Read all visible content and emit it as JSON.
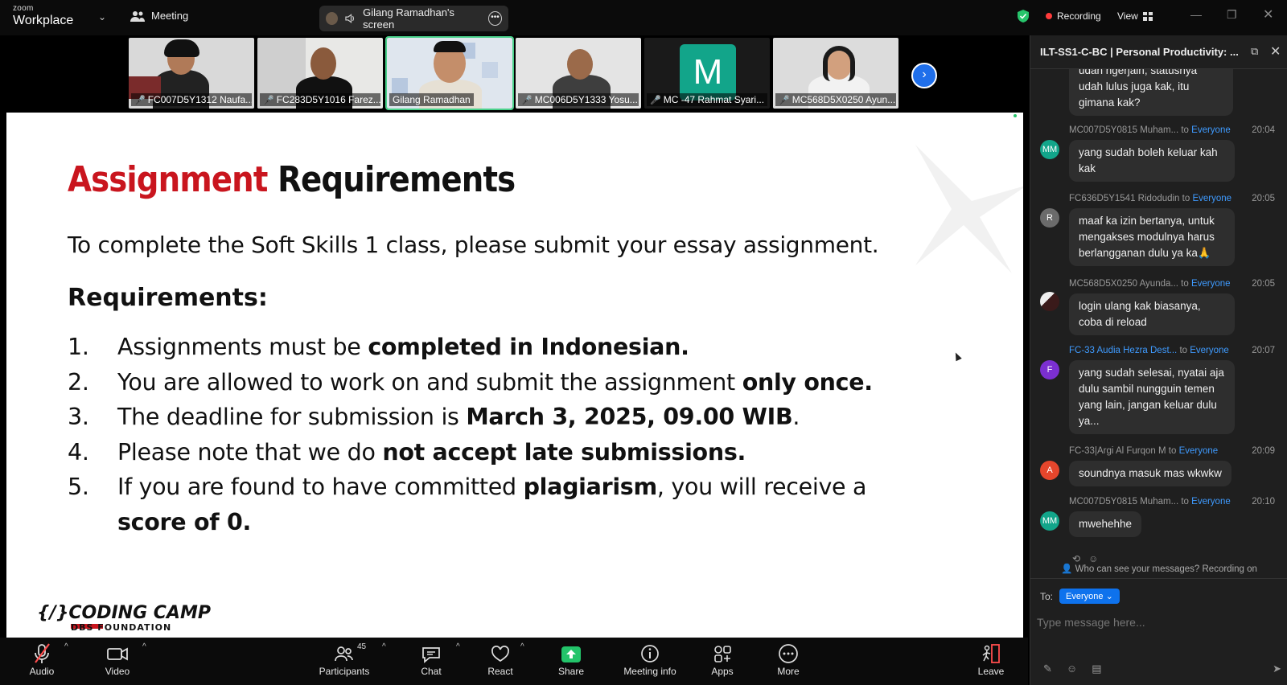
{
  "topbar": {
    "brand_small": "zoom",
    "brand_main": "Workplace",
    "meeting_label": "Meeting",
    "screen_share_label": "Gilang Ramadhan's screen",
    "recording_label": "Recording",
    "view_label": "View"
  },
  "thumbnails": [
    {
      "label": "FC007D5Y1312 Naufa...",
      "muted": true
    },
    {
      "label": "FC283D5Y1016 Farez...",
      "muted": true
    },
    {
      "label": "Gilang Ramadhan",
      "muted": false,
      "active": true
    },
    {
      "label": "MC006D5Y1333 Yosu...",
      "muted": true
    },
    {
      "label": "MC -47 Rahmat Syari...",
      "muted": true,
      "avatar_letter": "M"
    },
    {
      "label": "MC568D5X0250 Ayun...",
      "muted": true
    }
  ],
  "slide": {
    "title_red": "Assignment",
    "title_black": "Requirements",
    "intro": "To complete the Soft Skills 1 class, please submit your essay assignment.",
    "req_heading": "Requirements:",
    "items": [
      {
        "num": "1.",
        "pre": "Assignments must be ",
        "bold": "completed in Indonesian.",
        "post": ""
      },
      {
        "num": "2.",
        "pre": "You are allowed to work on and submit the assignment ",
        "bold": "only once.",
        "post": ""
      },
      {
        "num": "3.",
        "pre": "The deadline for submission is ",
        "bold": "March 3, 2025, 09.00 WIB",
        "post": "."
      },
      {
        "num": "4.",
        "pre": "Please note that we do ",
        "bold": "not accept late submissions.",
        "post": ""
      },
      {
        "num": "5.",
        "pre": "If you are found to have committed ",
        "bold": "plagiarism",
        "post": ", you will receive a"
      },
      {
        "num": "",
        "pre": "",
        "bold": "score of 0.",
        "post": ""
      }
    ],
    "logo_text": "{/}CODING CAMP",
    "logo_sub": "DBS FOUNDATION"
  },
  "toolbar": {
    "audio": "Audio",
    "video": "Video",
    "participants": "Participants",
    "participants_count": "45",
    "chat": "Chat",
    "react": "React",
    "share": "Share",
    "meeting_info": "Meeting info",
    "apps": "Apps",
    "more": "More",
    "leave": "Leave"
  },
  "chat": {
    "title": "ILT-SS1-C-BC | Personal Productivity: ...",
    "to_word": "to",
    "everyone": "Everyone",
    "messages": [
      {
        "avatar": "",
        "color": "",
        "sender": "",
        "time": "",
        "lines": "udah ngerjain, statusnya udah lulus juga kak, itu gimana kak?"
      },
      {
        "avatar": "MM",
        "color": "#12a58a",
        "sender": "MC007D5Y0815 Muham...",
        "time": "20:04",
        "lines": "yang sudah boleh keluar kah kak"
      },
      {
        "avatar": "R",
        "color": "#6b6b6b",
        "sender": "FC636D5Y1541 Ridodudin",
        "time": "20:05",
        "lines": "maaf ka izin bertanya, untuk mengakses modulnya harus berlangganan dulu ya ka🙏"
      },
      {
        "avatar": "",
        "color": "#444",
        "sender": "MC568D5X0250 Ayunda...",
        "time": "20:05",
        "lines": "login ulang kak biasanya, coba di reload"
      },
      {
        "avatar": "F",
        "color": "#7b2fd1",
        "sender": "FC-33 Audia Hezra Dest...",
        "time": "20:07",
        "lines": "yang sudah selesai, nyatai aja dulu sambil nungguin temen yang lain, jangan keluar dulu ya..."
      },
      {
        "avatar": "A",
        "color": "#e5462c",
        "sender": "FC-33|Argi Al Furqon M",
        "time": "20:09",
        "lines": "soundnya masuk mas wkwkw"
      },
      {
        "avatar": "MM",
        "color": "#12a58a",
        "sender": "MC007D5Y0815 Muham...",
        "time": "20:10",
        "lines": "mwehehhe"
      }
    ],
    "who_can_see": "Who can see your messages? Recording on",
    "to_label": "To:",
    "to_value": "Everyone",
    "input_placeholder": "Type message here..."
  },
  "colors": {
    "accent_red": "#c9151e",
    "zoom_blue": "#0e72ed",
    "share_green": "#23c46a",
    "active_border": "#4ad18b"
  }
}
